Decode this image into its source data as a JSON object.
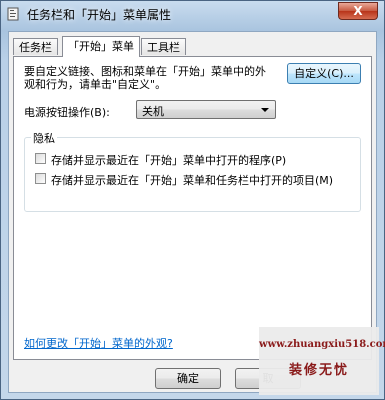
{
  "window": {
    "title": "任务栏和「开始」菜单属性",
    "close_glyph": "X"
  },
  "tabs": [
    {
      "label": "任务栏",
      "active": false
    },
    {
      "label": "「开始」菜单",
      "active": true
    },
    {
      "label": "工具栏",
      "active": false
    }
  ],
  "start_menu": {
    "customize_desc": "要自定义链接、图标和菜单在「开始」菜单中的外观和行为，请单击\"自定义\"。",
    "customize_button": "自定义(C)...",
    "power_label": "电源按钮操作(B):",
    "power_value": "关机",
    "privacy": {
      "title": "隐私",
      "items": [
        {
          "label": "存储并显示最近在「开始」菜单中打开的程序(P)",
          "checked": false
        },
        {
          "label": "存储并显示最近在「开始」菜单和任务栏中打开的项目(M)",
          "checked": false
        }
      ]
    },
    "help_link": "如何更改「开始」菜单的外观?"
  },
  "buttons": {
    "ok": "确定",
    "cancel": "取"
  },
  "watermark": {
    "url": "www.zhuangxiu518.com",
    "name": "装修无忧"
  }
}
